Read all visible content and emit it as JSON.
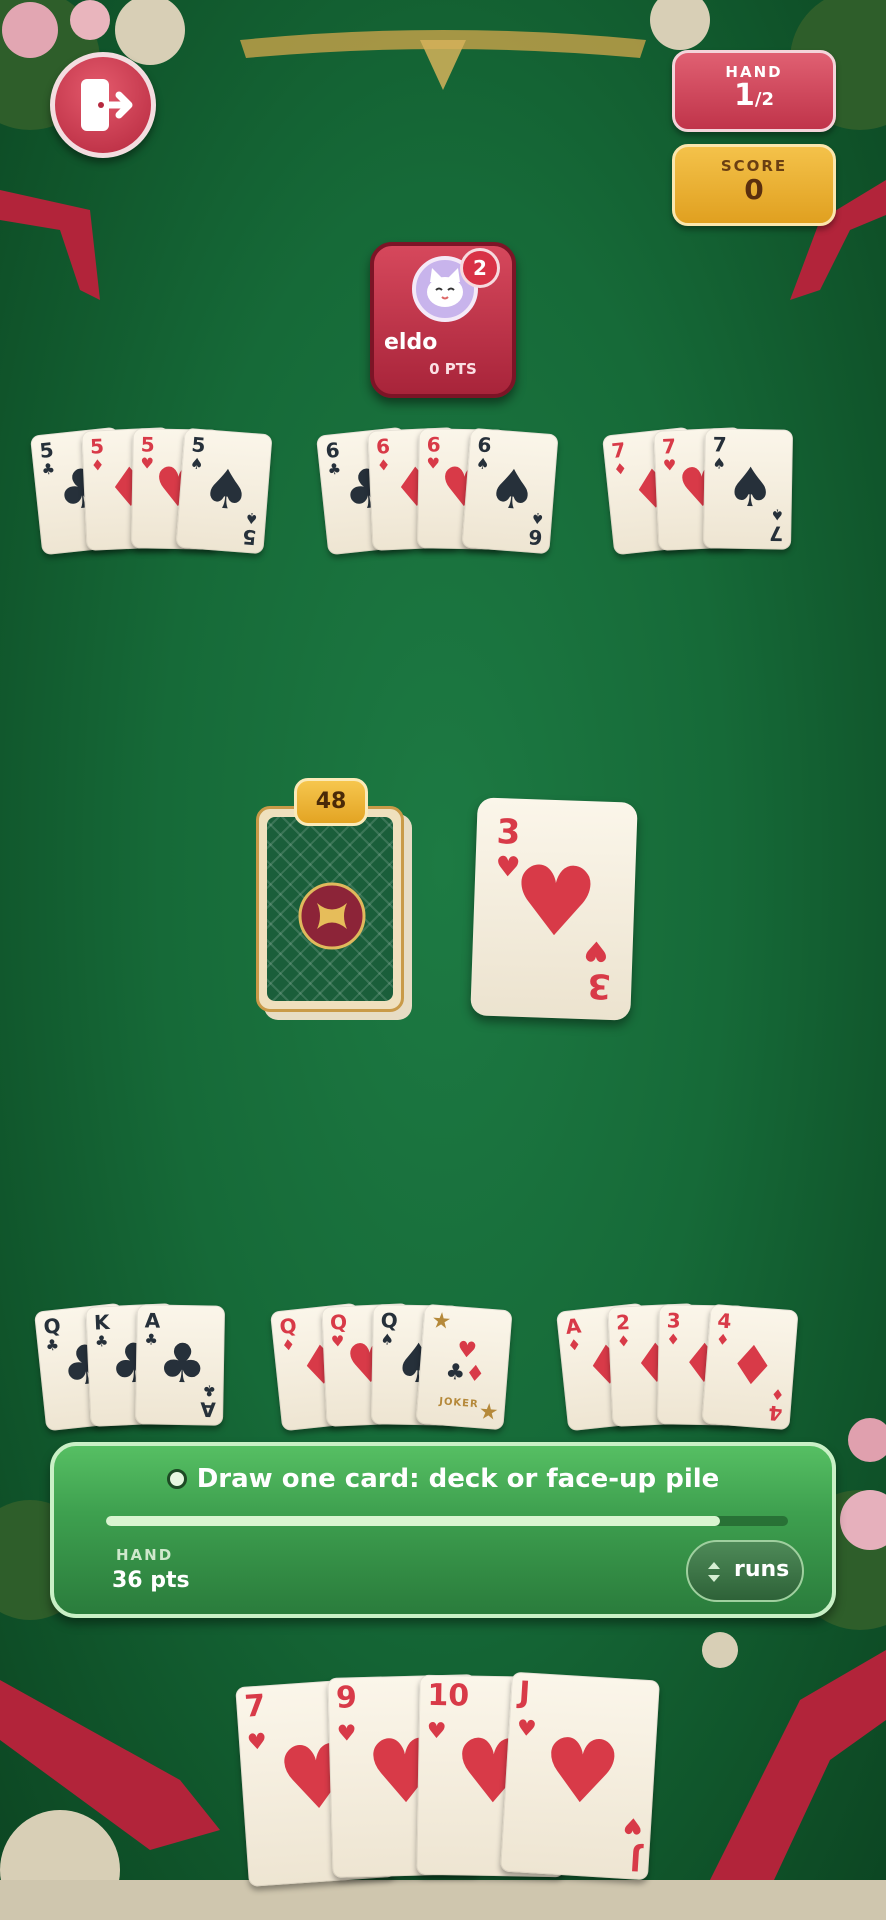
{
  "hud": {
    "hand_label": "HAND",
    "hand_current": "1",
    "hand_total": "/2",
    "score_label": "SCORE",
    "score_value": "0"
  },
  "opponent": {
    "name": "eldo",
    "points": "0 PTS",
    "badge": "2"
  },
  "table_melds": [
    [
      {
        "r": "5",
        "s": "♣"
      },
      {
        "r": "5",
        "s": "♦"
      },
      {
        "r": "5",
        "s": "♥"
      },
      {
        "r": "5",
        "s": "♠"
      }
    ],
    [
      {
        "r": "6",
        "s": "♣"
      },
      {
        "r": "6",
        "s": "♦"
      },
      {
        "r": "6",
        "s": "♥"
      },
      {
        "r": "6",
        "s": "♠"
      }
    ],
    [
      {
        "r": "7",
        "s": "♦"
      },
      {
        "r": "7",
        "s": "♥"
      },
      {
        "r": "7",
        "s": "♠"
      }
    ]
  ],
  "deck": {
    "count": "48"
  },
  "discard": {
    "r": "3",
    "s": "♥"
  },
  "player_melds": [
    [
      {
        "r": "Q",
        "s": "♣"
      },
      {
        "r": "K",
        "s": "♣"
      },
      {
        "r": "A",
        "s": "♣"
      }
    ],
    [
      {
        "r": "Q",
        "s": "♦"
      },
      {
        "r": "Q",
        "s": "♥"
      },
      {
        "r": "Q",
        "s": "♠"
      },
      {
        "joker": true,
        "label": "JOKER"
      }
    ],
    [
      {
        "r": "A",
        "s": "♦"
      },
      {
        "r": "2",
        "s": "♦"
      },
      {
        "r": "3",
        "s": "♦"
      },
      {
        "r": "4",
        "s": "♦"
      }
    ]
  ],
  "status": {
    "instruction": "Draw one card: deck or face-up pile",
    "progress": 0.9,
    "hand_label": "HAND",
    "hand_points": "36 pts",
    "sort_label": "runs"
  },
  "hand": [
    {
      "r": "7",
      "s": "♥"
    },
    {
      "r": "9",
      "s": "♥"
    },
    {
      "r": "10",
      "s": "♥"
    },
    {
      "r": "J",
      "s": "♥"
    }
  ],
  "colors": {
    "felt": "#166a38",
    "hud_red": "#c63a4d",
    "hud_gold": "#e8ad2c",
    "panel_green": "#43ad55"
  },
  "icons": {
    "exit": "exit-door-icon",
    "avatar": "cat-avatar-icon",
    "sort": "sort-arrows-icon"
  }
}
